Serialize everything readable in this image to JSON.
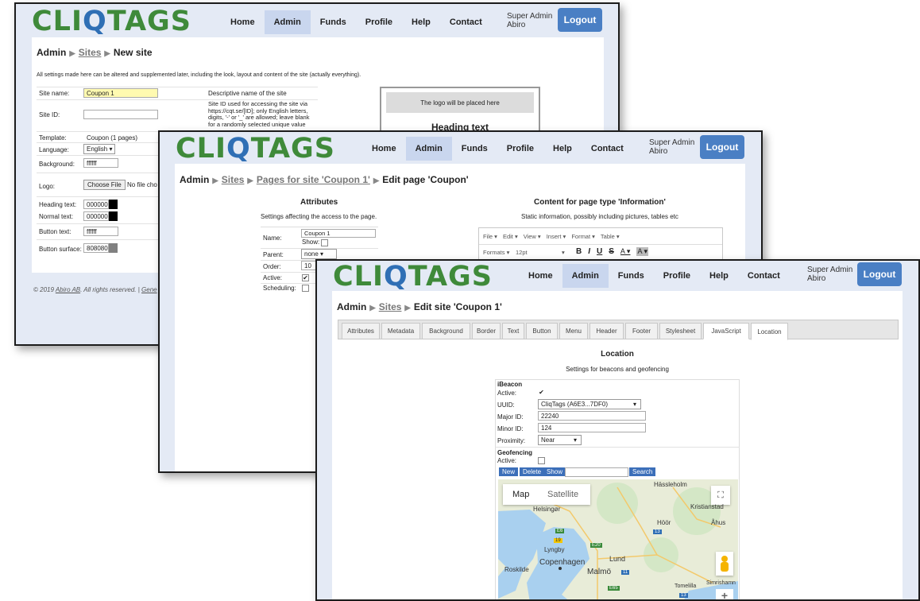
{
  "brand": {
    "logo_pre": "CLI",
    "logo_q": "Q",
    "logo_post": "TAGS"
  },
  "nav": [
    "Home",
    "Admin",
    "Funds",
    "Profile",
    "Help",
    "Contact"
  ],
  "user": {
    "line1": "Super Admin",
    "line2": "Abiro"
  },
  "logout": "Logout",
  "win1": {
    "breadcrumb": {
      "root": "Admin",
      "link": "Sites",
      "current": "New site"
    },
    "intro": "All settings made here can be altered and supplemented later, including the look, layout and content of the site (actually everything).",
    "site_name_label": "Site name:",
    "site_name_value": "Coupon 1",
    "site_name_desc": "Descriptive name of the site",
    "site_id_label": "Site ID:",
    "site_id_desc": [
      "Site ID used for accessing the site via",
      "https://cqt.se/[ID]; only English letters,",
      "digits, '-' or '_' are allowed; leave blank",
      "for a randomly selected unique value"
    ],
    "template_label": "Template:",
    "template_value": "Coupon (1 pages)",
    "language_label": "Language:",
    "language_value": "English ▾",
    "background_label": "Background:",
    "background_value": "ffffff",
    "logo_label": "Logo:",
    "choose_file": "Choose File",
    "no_file": "No file cho",
    "heading_text_label": "Heading text:",
    "heading_text_value": "000000",
    "normal_text_label": "Normal text:",
    "normal_text_value": "000000",
    "button_text_label": "Button text:",
    "button_text_value": "ffffff",
    "button_surface_label": "Button surface:",
    "button_surface_value": "808080",
    "preview_logo": "The logo will be placed here",
    "preview_heading": "Heading text",
    "footer_prefix": "© 2019 ",
    "footer_company": "Abiro AB",
    "footer_rest": ". All rights reserved. | ",
    "footer_link": "Gene"
  },
  "win2": {
    "breadcrumb": {
      "root": "Admin",
      "link1": "Sites",
      "link2": "Pages for site 'Coupon 1'",
      "current": "Edit page 'Coupon'"
    },
    "attributes_title": "Attributes",
    "attributes_sub": "Settings affecting the access to the page.",
    "name_label": "Name:",
    "name_value": "Coupon 1",
    "show_label": "Show:",
    "parent_label": "Parent:",
    "parent_value": "none ▾",
    "order_label": "Order:",
    "order_value": "10",
    "active_label": "Active:",
    "scheduling_label": "Scheduling:",
    "content_title": "Content for page type 'Information'",
    "content_sub": "Static information, possibly including pictures, tables etc",
    "menus": [
      "File ▾",
      "Edit ▾",
      "View ▾",
      "Insert ▾",
      "Format ▾",
      "Table ▾"
    ],
    "formats": "Formats ▾",
    "font_size": "12pt",
    "fmt_buttons": [
      "B",
      "I",
      "U",
      "S",
      "A ▾",
      "A ▾"
    ]
  },
  "win3": {
    "breadcrumb": {
      "root": "Admin",
      "link": "Sites",
      "current": "Edit site 'Coupon 1'"
    },
    "tabs": [
      "Attributes",
      "Metadata",
      "Background",
      "Border",
      "Text",
      "Button",
      "Menu",
      "Header",
      "Footer",
      "Stylesheet",
      "JavaScript",
      "Location"
    ],
    "active_tab": "Location",
    "section_title": "Location",
    "section_sub": "Settings for beacons and geofencing",
    "ibeacon_title": "iBeacon",
    "ibeacon_active_label": "Active:",
    "uuid_label": "UUID:",
    "uuid_value": "CliqTags (A6E3...7DF0)",
    "major_label": "Major ID:",
    "major_value": "22240",
    "minor_label": "Minor ID:",
    "minor_value": "124",
    "proximity_label": "Proximity:",
    "proximity_value": "Near",
    "geofencing_title": "Geofencing",
    "geofencing_active_label": "Active:",
    "btn_new": "New",
    "btn_delete": "Delete",
    "btn_show": "Show",
    "btn_search": "Search",
    "map_tab_map": "Map",
    "map_tab_satellite": "Satellite",
    "places": [
      "Hässleholm",
      "Kristianstad",
      "Helsingør",
      "Höör",
      "Åhus",
      "Lyngby",
      "Lund",
      "Copenhagen",
      "Roskilde",
      "Malmö",
      "Tomelilla",
      "Simrishamn"
    ],
    "road_badges": [
      "19",
      "E6",
      "E20",
      "13",
      "11",
      "E65",
      "13"
    ],
    "zoom_in": "+"
  },
  "colors": {
    "logo_green": "#3f8a3a",
    "logo_blue": "#2f6fb5",
    "nav_active": "#c9d6ee",
    "logout": "#4a7fc4",
    "frame_bg": "#e4eaf5",
    "map_water": "#a9d0ef",
    "map_land": "#e8ecd8"
  }
}
